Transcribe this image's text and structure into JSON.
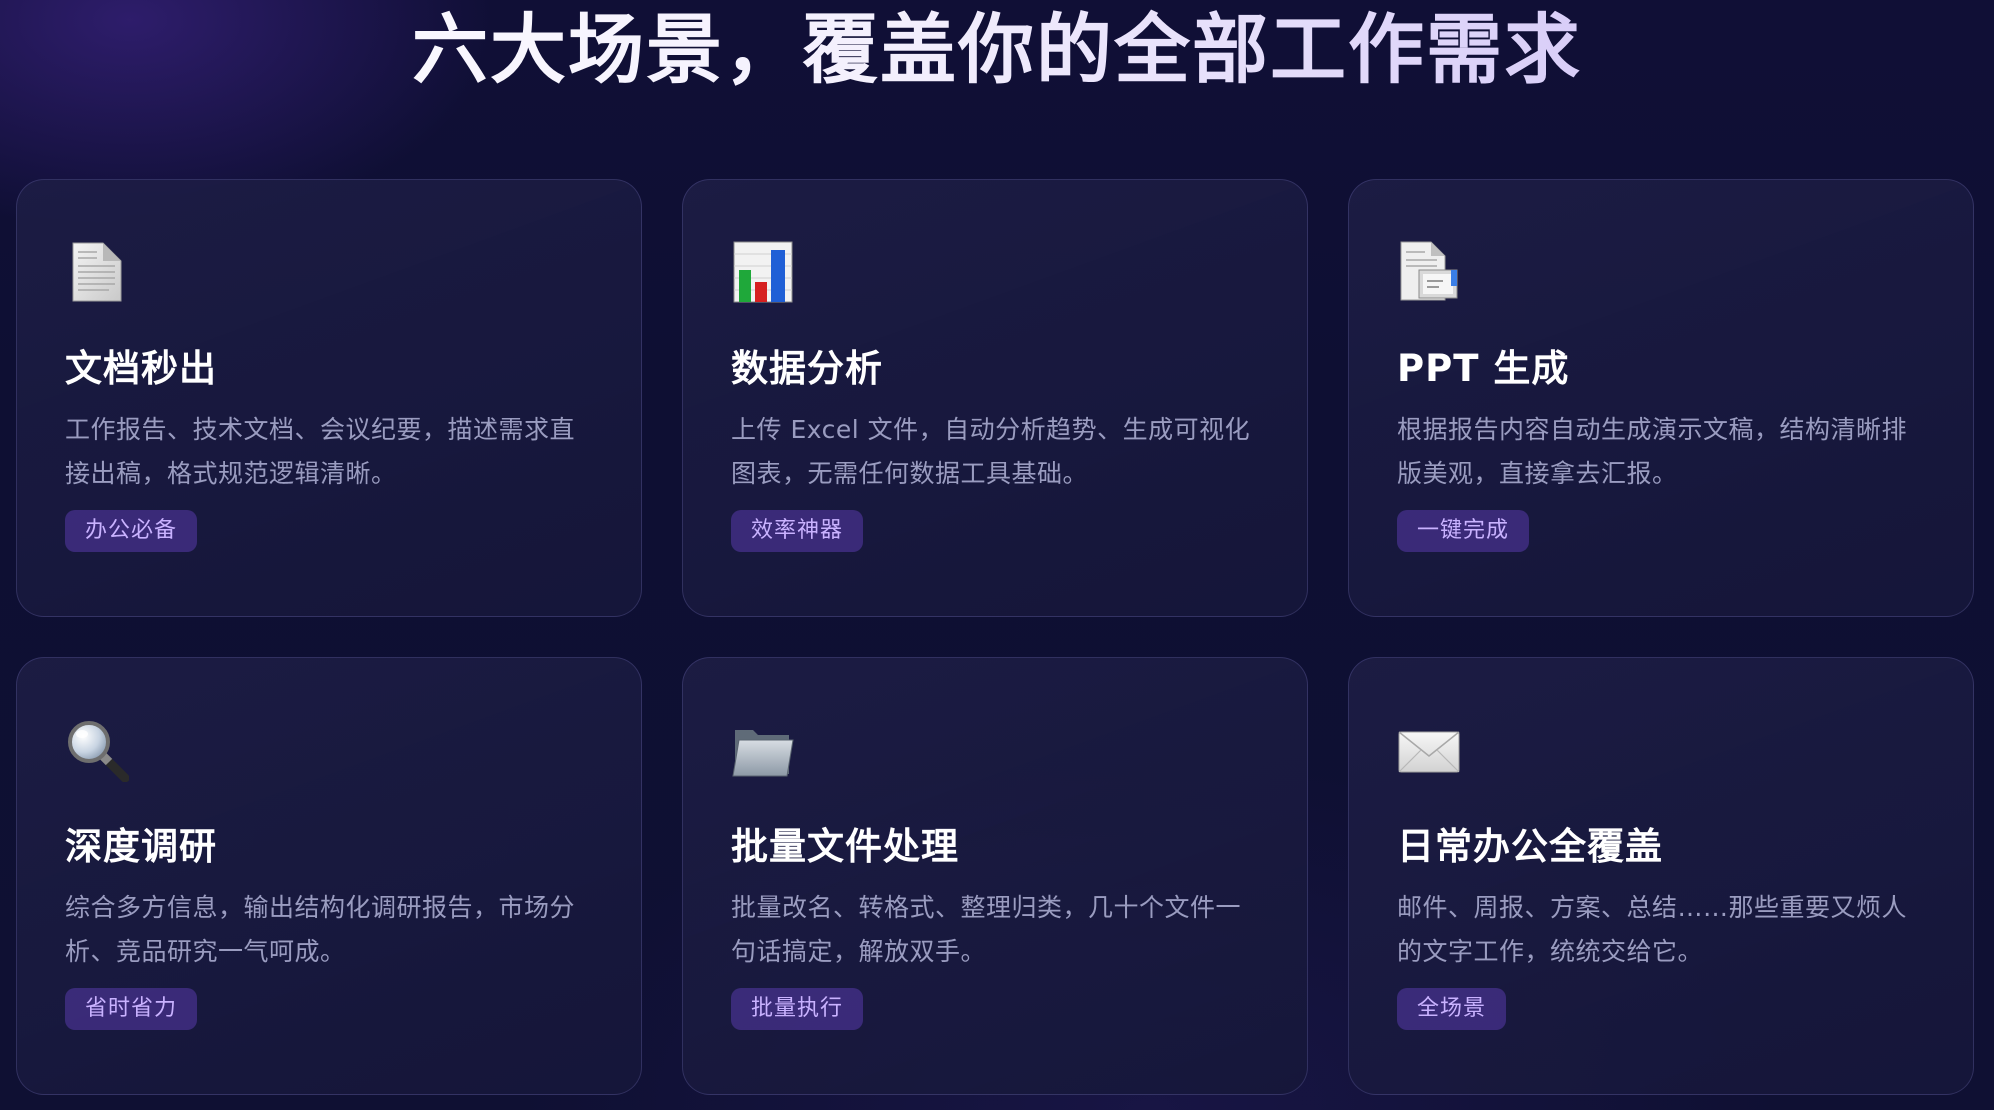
{
  "page": {
    "title": "六大场景，覆盖你的全部工作需求"
  },
  "cards": [
    {
      "icon": "document-icon",
      "title": "文档秒出",
      "desc_line1": "工作报告、技术文档、会议纪要，描述需求直",
      "desc_line2": "接出稿，格式规范逻辑清晰。",
      "badge": "办公必备"
    },
    {
      "icon": "bar-chart-icon",
      "title": "数据分析",
      "desc_line1": "上传 Excel 文件，自动分析趋势、生成可视化",
      "desc_line2": "图表，无需任何数据工具基础。",
      "badge": "效率神器"
    },
    {
      "icon": "presentation-document-icon",
      "title": "PPT 生成",
      "desc_line1": "根据报告内容自动生成演示文稿，结构清晰排",
      "desc_line2": "版美观，直接拿去汇报。",
      "badge": "一键完成"
    },
    {
      "icon": "magnifier-icon",
      "title": "深度调研",
      "desc_line1": "综合多方信息，输出结构化调研报告，市场分",
      "desc_line2": "析、竞品研究一气呵成。",
      "badge": "省时省力"
    },
    {
      "icon": "folder-icon",
      "title": "批量文件处理",
      "desc_line1": "批量改名、转格式、整理归类，几十个文件一",
      "desc_line2": "句话搞定，解放双手。",
      "badge": "批量执行"
    },
    {
      "icon": "envelope-icon",
      "title": "日常办公全覆盖",
      "desc_line1": "邮件、周报、方案、总结……那些重要又烦人",
      "desc_line2": "的文字工作，统统交给它。",
      "badge": "全场景"
    }
  ],
  "colors": {
    "background": "#0f1033",
    "card_background": "#1a1b45",
    "badge_background": "#3c2a7a",
    "badge_text": "#c9b2ff",
    "description": "#9a9cc0",
    "title": "#ffffff"
  }
}
